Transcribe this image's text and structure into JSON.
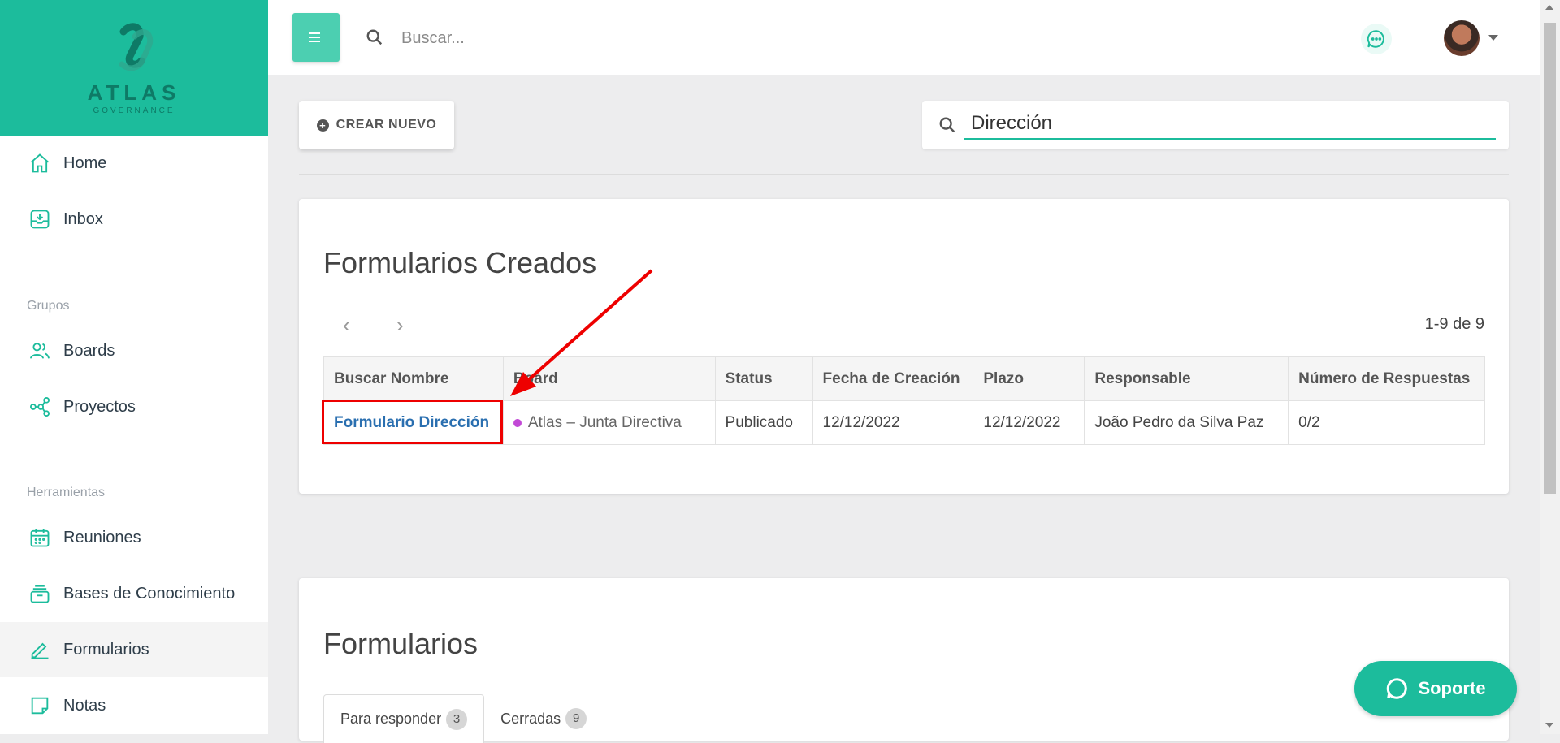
{
  "brand": {
    "name": "ATLAS",
    "tagline": "GOVERNANCE",
    "accent": "#1cbc9c"
  },
  "sidebar": {
    "items": [
      {
        "label": "Home",
        "icon": "home-icon"
      },
      {
        "label": "Inbox",
        "icon": "inbox-icon"
      },
      {
        "label": "Boards",
        "icon": "users-icon"
      },
      {
        "label": "Proyectos",
        "icon": "share-nodes-icon"
      },
      {
        "label": "Reuniones",
        "icon": "calendar-icon"
      },
      {
        "label": "Bases de Conocimiento",
        "icon": "archive-icon"
      },
      {
        "label": "Formularios",
        "icon": "pen-icon",
        "active": true
      },
      {
        "label": "Notas",
        "icon": "note-icon"
      }
    ],
    "sections": {
      "groups": "Grupos",
      "tools": "Herramientas"
    }
  },
  "topbar": {
    "search_placeholder": "Buscar..."
  },
  "toolbar": {
    "create_label": "CREAR NUEVO",
    "filter_value": "Dirección"
  },
  "created_forms": {
    "title": "Formularios Creados",
    "pager": "1-9 de 9",
    "columns": [
      "Buscar Nombre",
      "Board",
      "Status",
      "Fecha de Creación",
      "Plazo",
      "Responsable",
      "Número de Respuestas"
    ],
    "rows": [
      {
        "name": "Formulario Dirección",
        "board": "Atlas – Junta Directiva",
        "status": "Publicado",
        "created": "12/12/2022",
        "deadline": "12/12/2022",
        "owner": "João Pedro da Silva Paz",
        "responses": "0/2"
      }
    ]
  },
  "forms": {
    "title": "Formularios",
    "tabs": [
      {
        "label": "Para responder",
        "count": "3"
      },
      {
        "label": "Cerradas",
        "count": "9"
      }
    ]
  },
  "support": {
    "label": "Soporte"
  }
}
